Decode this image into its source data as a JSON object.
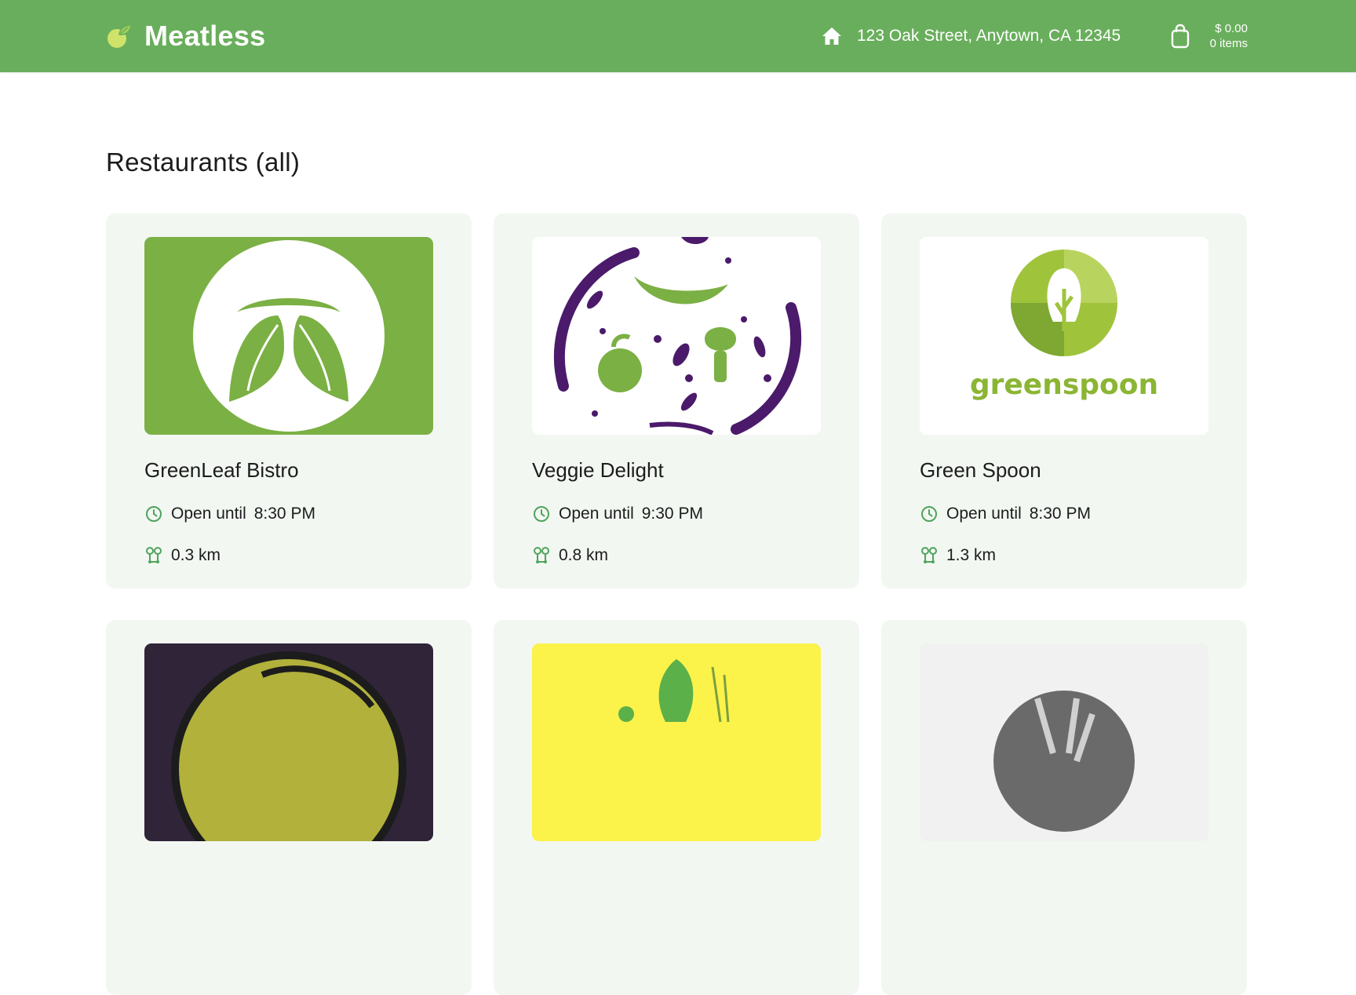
{
  "header": {
    "brand_name": "Meatless",
    "address": "123 Oak Street, Anytown, CA 12345",
    "cart": {
      "total": "$ 0.00",
      "items": "0 items"
    }
  },
  "main": {
    "title": "Restaurants (all)",
    "restaurants": [
      {
        "name": "GreenLeaf Bistro",
        "hours_label": "Open until",
        "hours_time": "8:30 PM",
        "distance": "0.3 km"
      },
      {
        "name": "Veggie Delight",
        "hours_label": "Open until",
        "hours_time": "9:30 PM",
        "distance": "0.8 km"
      },
      {
        "name": "Green Spoon",
        "hours_label": "Open until",
        "hours_time": "8:30 PM",
        "distance": "1.3 km",
        "logo_text": "greenspoon"
      },
      {
        "name": "",
        "hours_label": "",
        "hours_time": "",
        "distance": ""
      },
      {
        "name": "",
        "hours_label": "",
        "hours_time": "",
        "distance": ""
      },
      {
        "name": "",
        "hours_label": "",
        "hours_time": "",
        "distance": ""
      }
    ]
  },
  "icons": {
    "brand": "leaf-logo-icon",
    "address": "home-icon",
    "cart": "shopping-bag-icon",
    "hours": "clock-icon",
    "distance": "route-pin-icon"
  },
  "colors": {
    "header_bg": "#69ae5c",
    "card_bg": "#f2f7f2",
    "accent_icon": "#4fa35c",
    "brand_logo": "#cfe36b"
  }
}
